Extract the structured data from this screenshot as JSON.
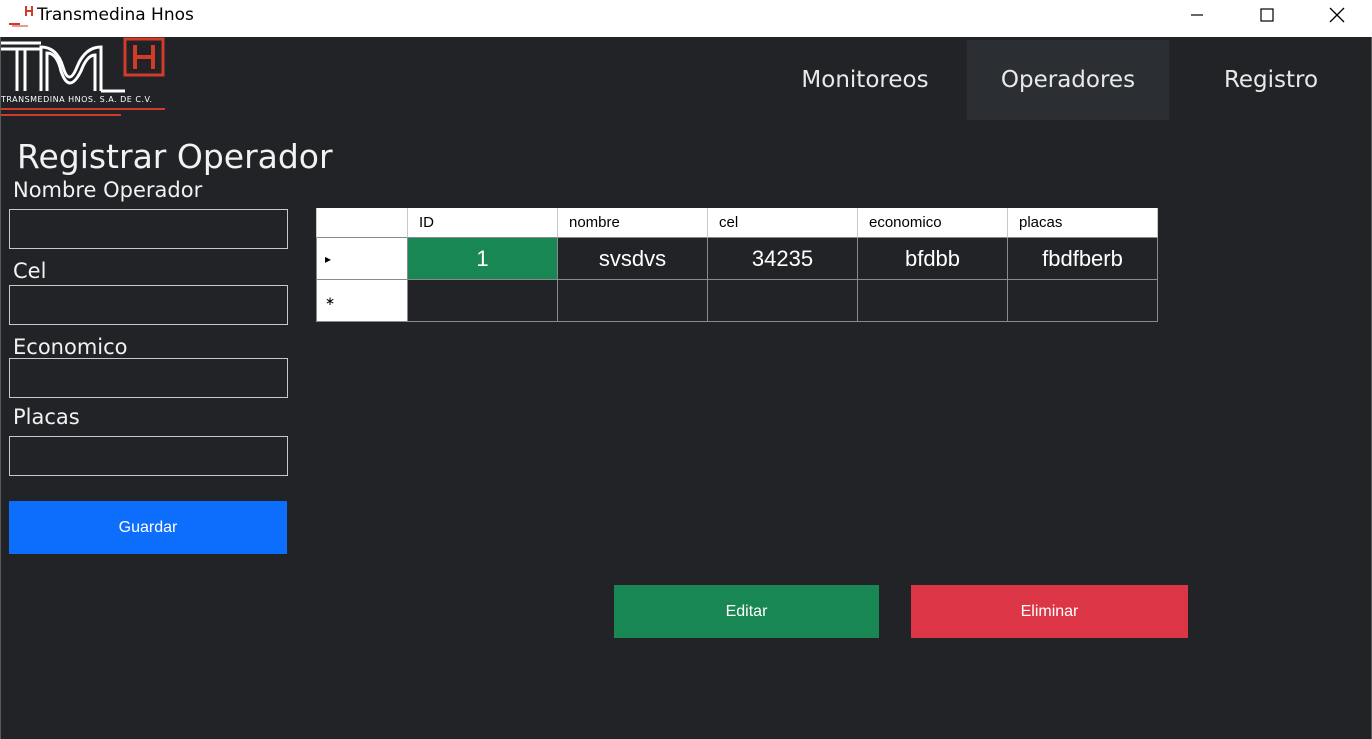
{
  "window": {
    "title": "Transmedina Hnos",
    "logo_text": "TRANSMEDINA HNOS. S.A. DE C.V."
  },
  "nav": {
    "items": [
      {
        "label": "Monitoreos"
      },
      {
        "label": "Operadores"
      },
      {
        "label": "Registro"
      }
    ]
  },
  "form": {
    "title": "Registrar Operador",
    "fields": [
      {
        "label": "Nombre Operador",
        "value": ""
      },
      {
        "label": "Cel",
        "value": ""
      },
      {
        "label": "Economico",
        "value": ""
      },
      {
        "label": "Placas",
        "value": ""
      }
    ],
    "save_label": "Guardar"
  },
  "table": {
    "columns": [
      "ID",
      "nombre",
      "cel",
      "economico",
      "placas"
    ],
    "rows": [
      [
        "1",
        "svsdvs",
        "34235",
        "bfdbb",
        "fbdfberb"
      ]
    ],
    "current_row_marker": "▸",
    "new_row_marker": "∗"
  },
  "actions": {
    "edit_label": "Editar",
    "delete_label": "Eliminar"
  },
  "colors": {
    "background": "#212327",
    "primary": "#0d6efd",
    "success": "#198754",
    "danger": "#dc3545",
    "nav_active": "#2b2e33"
  }
}
